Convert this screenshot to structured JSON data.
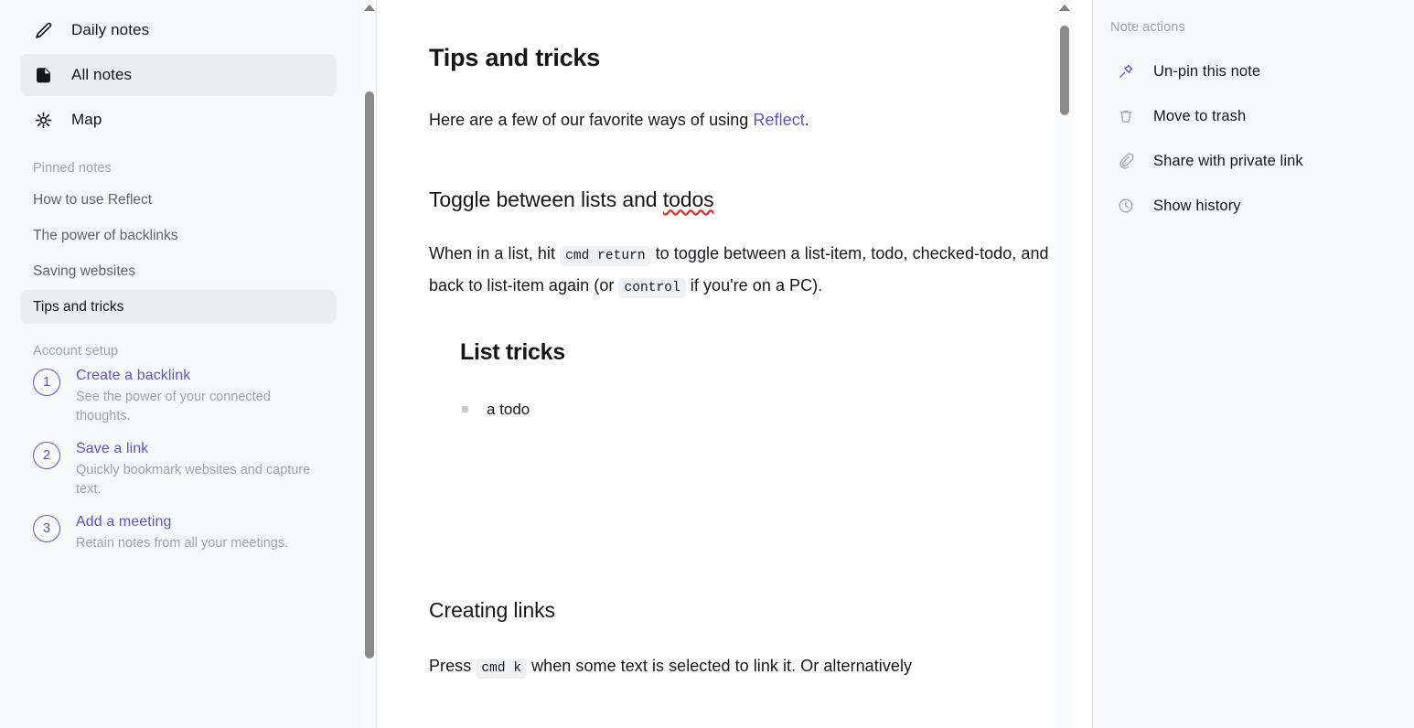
{
  "sidebar": {
    "nav": [
      {
        "label": "Daily notes",
        "icon": "pencil-icon",
        "active": false
      },
      {
        "label": "All notes",
        "icon": "document-icon",
        "active": true
      },
      {
        "label": "Map",
        "icon": "sun-map-icon",
        "active": false
      }
    ],
    "pinned_header": "Pinned notes",
    "pinned": [
      {
        "label": "How to use Reflect",
        "active": false
      },
      {
        "label": "The power of backlinks",
        "active": false
      },
      {
        "label": "Saving websites",
        "active": false
      },
      {
        "label": "Tips and tricks",
        "active": true
      }
    ],
    "setup_header": "Account setup",
    "setup": [
      {
        "num": "1",
        "title": "Create a backlink",
        "desc": "See the power of your connected thoughts."
      },
      {
        "num": "2",
        "title": "Save a link",
        "desc": "Quickly bookmark websites and capture text."
      },
      {
        "num": "3",
        "title": "Add a meeting",
        "desc": "Retain notes from all your meetings."
      }
    ]
  },
  "document": {
    "title": "Tips and tricks",
    "intro_before": "Here are a few of our favorite ways of using ",
    "intro_link": "Reflect",
    "intro_after": ".",
    "heading_toggle_a": "Toggle between lists and ",
    "heading_toggle_b": "todos",
    "para1_a": "When in a list, hit ",
    "para1_kbd1": "cmd return",
    "para1_b": " to toggle between a list-item, todo, checked-todo, and back to list-item again (or ",
    "para1_kbd2": "control",
    "para1_c": " if you're on a PC).",
    "list_heading": "List tricks",
    "todo_item": "a todo",
    "heading_links": "Creating links",
    "para2_a": "Press ",
    "para2_kbd": "cmd k",
    "para2_b": " when some text is selected to link it. Or alternatively"
  },
  "note_actions": {
    "title": "Note actions",
    "items": [
      {
        "label": "Un-pin this note",
        "icon": "pin-icon"
      },
      {
        "label": "Move to trash",
        "icon": "trash-icon"
      },
      {
        "label": "Share with private link",
        "icon": "link-icon"
      },
      {
        "label": "Show history",
        "icon": "clock-icon"
      }
    ]
  },
  "colors": {
    "accent": "#5b54d6",
    "sidebar_bg": "#f8f9fa",
    "active_bg": "#eceef0",
    "muted_text": "#9ea4ad",
    "body_text": "#14161a",
    "spellcheck": "#e02b2b",
    "code_bg": "#f0f1f3"
  }
}
